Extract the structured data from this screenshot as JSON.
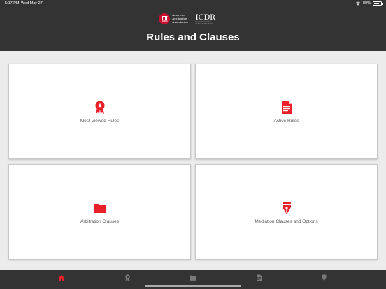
{
  "status_bar": {
    "time": "5:17 PM",
    "date": "Wed May 27",
    "battery_text": "80%",
    "battery_level": 0.8,
    "icons": [
      "wifi-icon",
      "battery-icon"
    ]
  },
  "header": {
    "logo_primary": [
      "American",
      "Arbitration",
      "Association"
    ],
    "logo_secondary": "ICDR",
    "logo_secondary_sub": [
      "International Centre",
      "for Dispute Resolution"
    ],
    "title": "Rules and Clauses"
  },
  "cards": [
    {
      "label": "Most Viewed Rules",
      "icon": "ribbon-award-icon"
    },
    {
      "label": "Active Rules",
      "icon": "document-icon"
    },
    {
      "label": "Arbitration Clauses",
      "icon": "folder-icon"
    },
    {
      "label": "Mediation Clauses and Options",
      "icon": "fountain-pen-icon"
    }
  ],
  "tabbar": {
    "tabs": [
      {
        "icon": "home-icon",
        "active": true
      },
      {
        "icon": "ribbon-icon",
        "active": false
      },
      {
        "icon": "folder-icon",
        "active": false
      },
      {
        "icon": "document-icon",
        "active": false
      },
      {
        "icon": "pen-icon",
        "active": false
      }
    ]
  },
  "colors": {
    "header_bg": "#333333",
    "page_bg": "#ececec",
    "accent_red": "#e8202a",
    "inactive_icon": "#7a7a7a",
    "card_text": "#555555"
  }
}
